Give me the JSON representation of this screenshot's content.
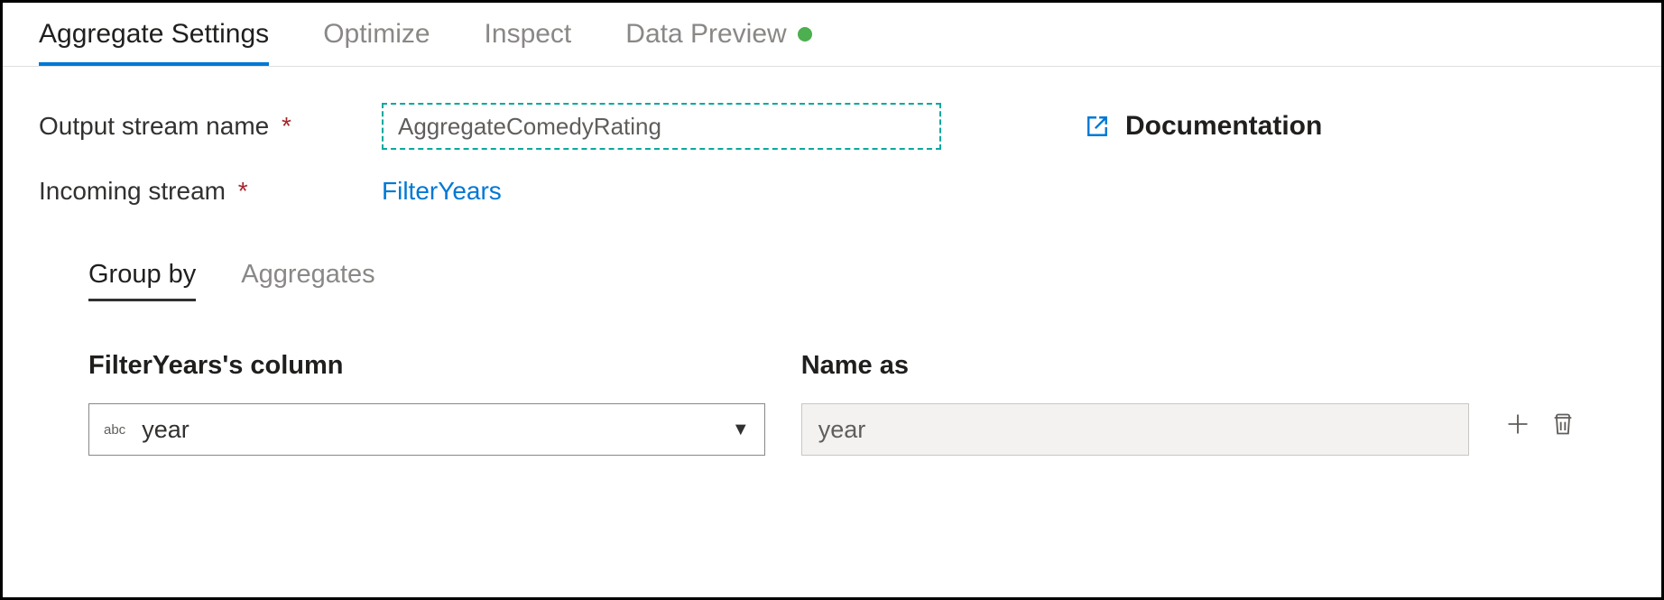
{
  "tabs": {
    "items": [
      {
        "label": "Aggregate Settings",
        "active": true
      },
      {
        "label": "Optimize",
        "active": false
      },
      {
        "label": "Inspect",
        "active": false
      },
      {
        "label": "Data Preview",
        "active": false,
        "hasStatus": true
      }
    ]
  },
  "form": {
    "outputStreamLabel": "Output stream name",
    "outputStreamValue": "AggregateComedyRating",
    "incomingStreamLabel": "Incoming stream",
    "incomingStreamValue": "FilterYears",
    "documentationLabel": "Documentation"
  },
  "subtabs": {
    "items": [
      {
        "label": "Group by",
        "active": true
      },
      {
        "label": "Aggregates",
        "active": false
      }
    ]
  },
  "groupBy": {
    "columnHeader": "FilterYears's column",
    "nameAsHeader": "Name as",
    "rows": [
      {
        "typeBadge": "abc",
        "columnValue": "year",
        "nameAsValue": "year"
      }
    ]
  }
}
